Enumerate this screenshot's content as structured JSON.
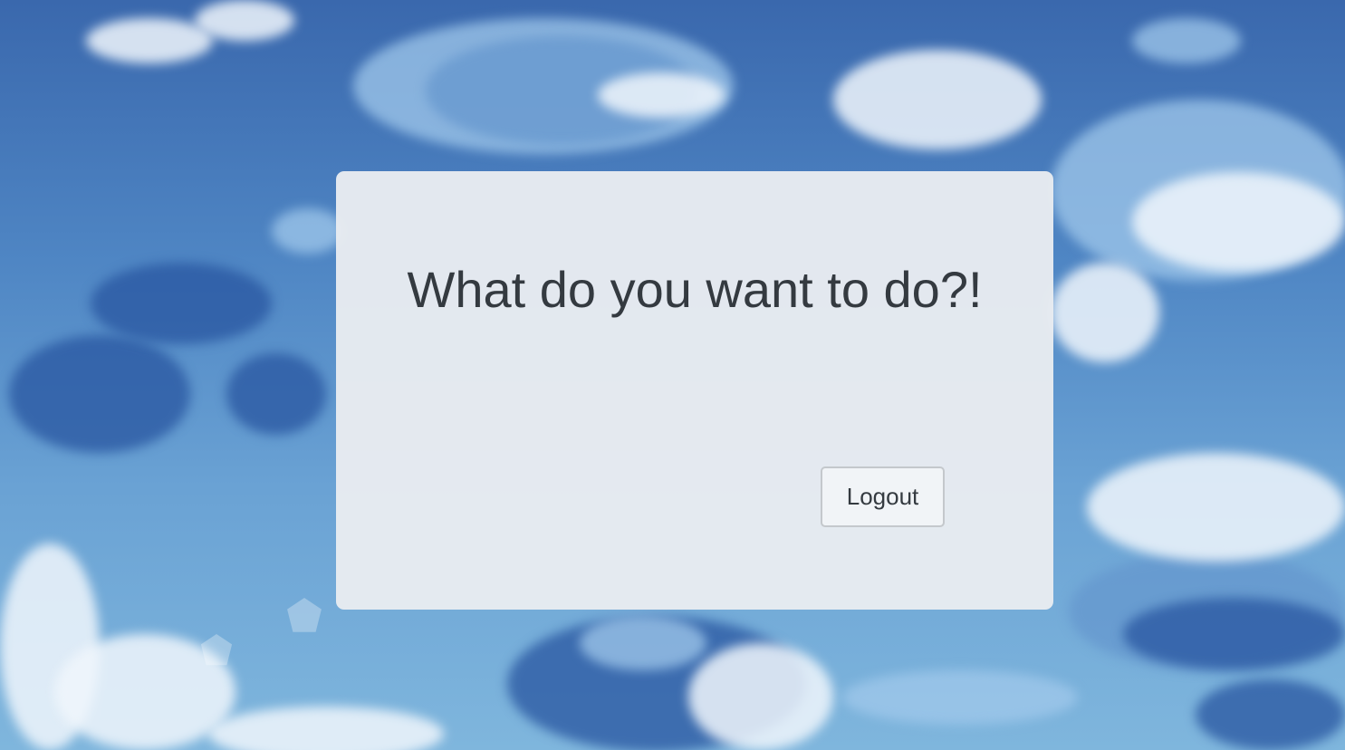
{
  "main": {
    "heading": "What do you want to do?!",
    "logout_label": "Logout"
  },
  "colors": {
    "card_background": "#e9ecf0",
    "text": "#343a40",
    "button_background": "#f1f4f7",
    "button_border": "#c4c8cc",
    "sky": "#4f86c4"
  }
}
